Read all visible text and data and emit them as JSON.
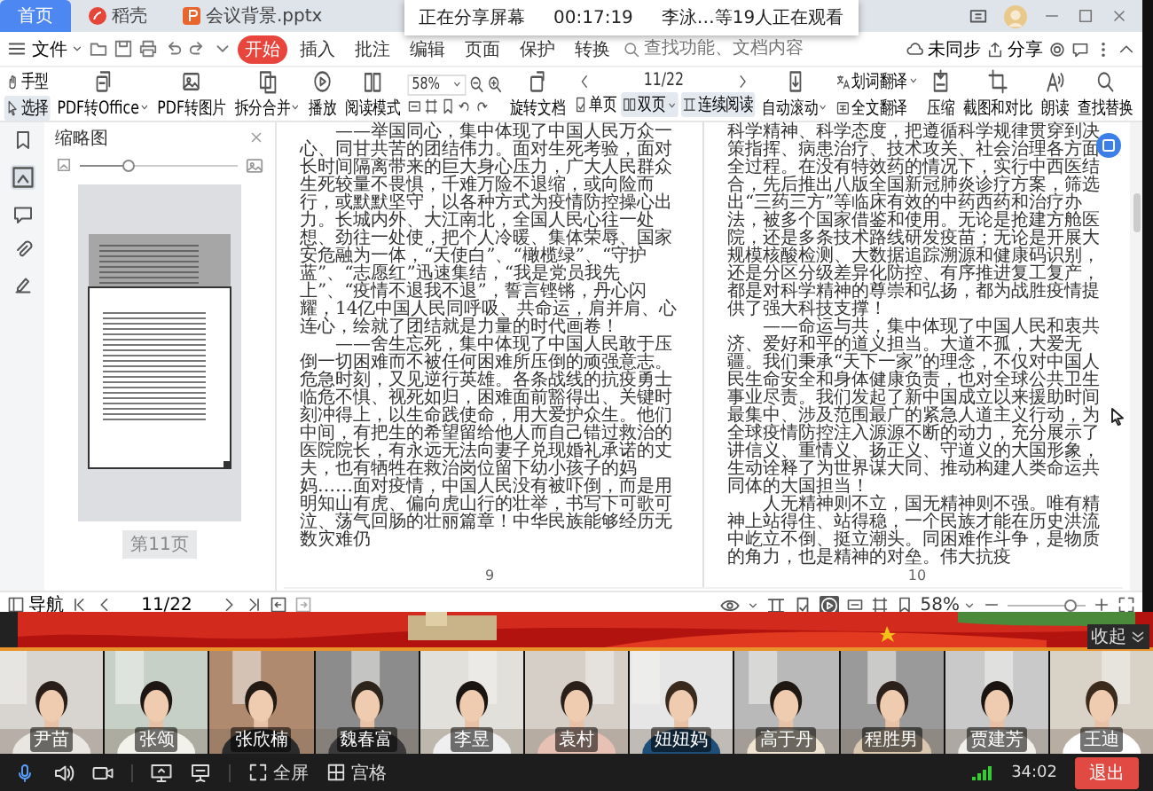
{
  "tabs": [
    {
      "label": "首页",
      "selected": true
    },
    {
      "label": "稻壳",
      "selected": false
    },
    {
      "label": "会议背景.pptx",
      "selected": false
    }
  ],
  "share_popup": {
    "status": "正在分享屏幕",
    "time": "00:17:19",
    "viewers": "李泳…等19人正在观看"
  },
  "menu": {
    "file": "文件",
    "items": [
      {
        "label": "开始",
        "selected": true
      },
      {
        "label": "插入",
        "selected": false
      },
      {
        "label": "批注",
        "selected": false
      },
      {
        "label": "编辑",
        "selected": false
      },
      {
        "label": "页面",
        "selected": false
      },
      {
        "label": "保护",
        "selected": false
      },
      {
        "label": "转换",
        "selected": false
      }
    ],
    "search": {
      "placeholder": "查找功能、文档内容"
    },
    "sync": "未同步",
    "share": "分享"
  },
  "toolbar": {
    "modes": [
      {
        "label": "手型",
        "selected": false
      },
      {
        "label": "选择",
        "selected": true
      }
    ],
    "tools": [
      {
        "label": "PDF转Office",
        "dropdown": true
      },
      {
        "label": "PDF转图片",
        "dropdown": false
      },
      {
        "label": "拆分合并",
        "dropdown": true
      },
      {
        "label": "播放",
        "dropdown": false
      },
      {
        "label": "阅读模式",
        "dropdown": false
      }
    ],
    "zoom": "58%",
    "rotate": "旋转文档",
    "page": "11/22",
    "layouts": [
      {
        "label": "单页",
        "selected": false,
        "dropdown": false
      },
      {
        "label": "双页",
        "selected": true,
        "dropdown": true
      },
      {
        "label": "连续阅读",
        "selected": true,
        "dropdown": false
      }
    ],
    "more_tools": [
      {
        "label": "自动滚动",
        "dropdown": true
      },
      {
        "label": "划词翻译",
        "dropdown": true
      },
      {
        "label": "全文翻译",
        "dropdown": false
      },
      {
        "label": "压缩",
        "dropdown": false
      },
      {
        "label": "截图和对比",
        "dropdown": false
      },
      {
        "label": "朗读",
        "dropdown": false
      },
      {
        "label": "查找替换",
        "dropdown": false
      }
    ]
  },
  "thumbnail_panel": {
    "title": "缩略图",
    "level": 0.3,
    "page_label": "第11页"
  },
  "document": {
    "pages": [
      {
        "paragraphs": [
          {
            "text": "——举国同心，集中体现了中国人民万众一心、同甘共苦的团结伟力。面对生死考验，面对长时间隔离带来的巨大身心压力，广大人民群众生死较量不畏惧，千难万险不退缩，或向险而行，或默默坚守，以各种方式为疫情防控操心出力。长城内外、大江南北，全国人民心往一处想、劲往一处使，把个人冷暖、集体荣辱、国家安危融为一体，“天使白”、“橄榄绿”、“守护蓝”、“志愿红”迅速集结，“我是党员我先上”、“疫情不退我不退”，誓言铿锵，丹心闪耀，14亿中国人民同呼吸、共命运，肩并肩、心连心，绘就了团结就是力量的时代画卷！",
            "continued": false
          },
          {
            "text": "——舍生忘死，集中体现了中国人民敢于压倒一切困难而不被任何困难所压倒的顽强意志。危急时刻，又见逆行英雄。各条战线的抗疫勇士临危不惧、视死如归，困难面前豁得出、关键时刻冲得上，以生命践使命，用大爱护众生。他们中间，有把生的希望留给他人而自己错过救治的医院院长，有永远无法向妻子兑现婚礼承诺的丈夫，也有牺牲在救治岗位留下幼小孩子的妈妈……面对疫情，中国人民没有被吓倒，而是用明知山有虎、偏向虎山行的壮举，书写下可歌可泣、荡气回肠的壮丽篇章！中华民族能够经历无数灾难仍",
            "continued": false
          }
        ],
        "page_number": "9"
      },
      {
        "paragraphs": [
          {
            "text": "科学精神、科学态度，把遵循科学规律贯穿到决策指挥、病患治疗、技术攻关、社会治理各方面全过程。在没有特效药的情况下，实行中西医结合，先后推出八版全国新冠肺炎诊疗方案，筛选出“三药三方”等临床有效的中药西药和治疗办法，被多个国家借鉴和使用。无论是抢建方舱医院，还是多条技术路线研发疫苗；无论是开展大规模核酸检测、大数据追踪溯源和健康码识别，还是分区分级差异化防控、有序推进复工复产，都是对科学精神的尊崇和弘扬，都为战胜疫情提供了强大科技支撑！",
            "continued": true
          },
          {
            "text": "——命运与共，集中体现了中国人民和衷共济、爱好和平的道义担当。大道不孤，大爱无疆。我们秉承“天下一家”的理念，不仅对中国人民生命安全和身体健康负责，也对全球公共卫生事业尽责。我们发起了新中国成立以来援助时间最集中、涉及范围最广的紧急人道主义行动，为全球疫情防控注入源源不断的动力，充分展示了讲信义、重情义、扬正义、守道义的大国形象，生动诠释了为世界谋大同、推动构建人类命运共同体的大国担当！",
            "continued": false
          },
          {
            "text": "人无精神则不立，国无精神则不强。唯有精神上站得住、站得稳，一个民族才能在历史洪流中屹立不倒、挺立潮头。同困难作斗争，是物质的角力，也是精神的对垒。伟大抗疫",
            "continued": false
          }
        ],
        "page_number": "10"
      }
    ]
  },
  "status_bar": {
    "nav": "导航",
    "page": "11/22",
    "layouts": [
      {
        "selected": false
      },
      {
        "selected": false
      },
      {
        "selected": true
      }
    ],
    "zoom": "58%",
    "level": 0.8
  },
  "banner": {
    "collapse": "收起"
  },
  "participants": [
    {
      "name": "尹苗"
    },
    {
      "name": "张颂"
    },
    {
      "name": "张欣楠"
    },
    {
      "name": "魏春富"
    },
    {
      "name": "李昱"
    },
    {
      "name": "袁村"
    },
    {
      "name": "妞妞妈"
    },
    {
      "name": "高于丹"
    },
    {
      "name": "程胜男"
    },
    {
      "name": "贾建芳"
    },
    {
      "name": "王迪"
    }
  ],
  "controls": {
    "fullscreen": "全屏",
    "grid": "宫格",
    "duration": "34:02",
    "leave": "退出"
  }
}
